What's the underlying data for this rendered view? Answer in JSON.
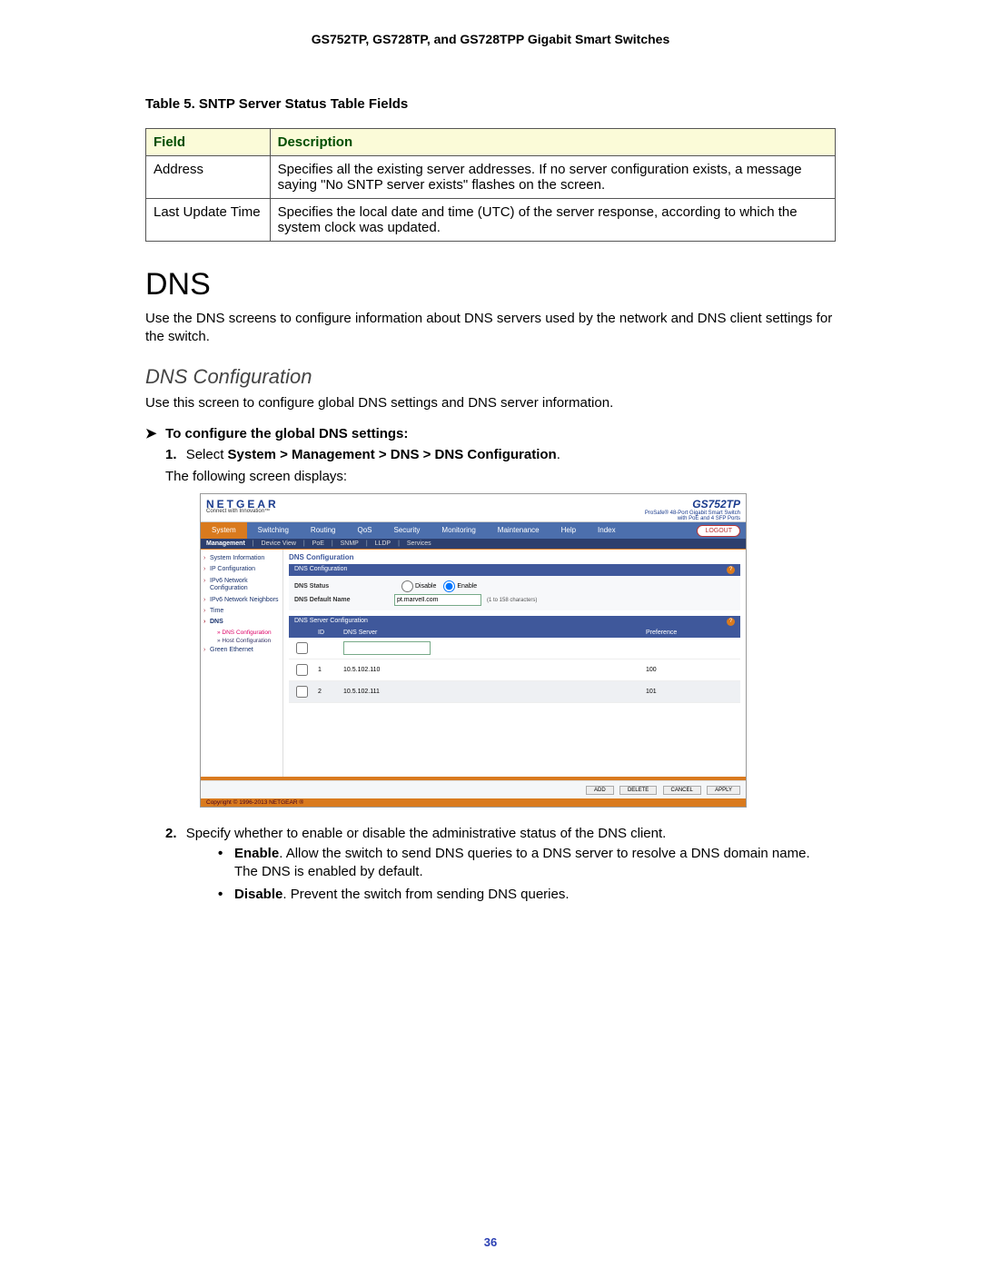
{
  "doc_title": "GS752TP, GS728TP, and GS728TPP Gigabit Smart Switches",
  "table_caption": "Table 5.  SNTP Server Status Table Fields",
  "table5": {
    "headers": [
      "Field",
      "Description"
    ],
    "rows": [
      {
        "field": "Address",
        "desc": "Specifies all the existing server addresses. If no server configuration exists, a message saying \"No SNTP server exists\" flashes on the screen."
      },
      {
        "field": "Last Update Time",
        "desc": "Specifies the local date and time (UTC) of the server response, according to which the system clock was updated."
      }
    ]
  },
  "dns_section": {
    "heading": "DNS",
    "intro": "Use the DNS screens to configure information about DNS servers used by the network and DNS client settings for the switch.",
    "sub_heading": "DNS Configuration",
    "sub_intro": "Use this screen to configure global DNS settings and DNS server information.",
    "procedure_title": "To configure the global DNS settings:",
    "step1_prefix": "Select ",
    "step1_route": "System > Management > DNS > DNS Configuration",
    "step1_suffix": ".",
    "after_step1": "The following screen displays:",
    "step2": "Specify whether to enable or disable the administrative status of the DNS client.",
    "bullets": [
      {
        "term": "Enable",
        "text": ". Allow the switch to send DNS queries to a DNS server to resolve a DNS domain name. The DNS is enabled by default."
      },
      {
        "term": "Disable",
        "text": ". Prevent the switch from sending DNS queries."
      }
    ]
  },
  "screenshot": {
    "brand": "NETGEAR",
    "tagline": "Connect with Innovation™",
    "model": "GS752TP",
    "model_desc1": "ProSafe® 48-Port Gigabit Smart Switch",
    "model_desc2": "with PoE and 4 SFP Ports",
    "logout": "LOGOUT",
    "tabs": [
      "System",
      "Switching",
      "Routing",
      "QoS",
      "Security",
      "Monitoring",
      "Maintenance",
      "Help",
      "Index"
    ],
    "active_tab": "System",
    "submenu": [
      "Management",
      "Device View",
      "PoE",
      "SNMP",
      "LLDP",
      "Services"
    ],
    "submenu_active": "Management",
    "sidebar": [
      "System Information",
      "IP Configuration",
      "IPv6 Network Configuration",
      "IPv6 Network Neighbors",
      "Time",
      "DNS",
      "Green Ethernet"
    ],
    "sidebar_subs": [
      "DNS Configuration",
      "Host Configuration"
    ],
    "sidebar_sub_active": "DNS Configuration",
    "panel_main_title": "DNS Configuration",
    "panel1_title": "DNS Configuration",
    "dns_status_label": "DNS Status",
    "dns_status_disable": "Disable",
    "dns_status_enable": "Enable",
    "dns_default_label": "DNS Default Name",
    "dns_default_value": "pt.marvell.com",
    "dns_default_hint": "(1 to 158 characters)",
    "panel2_title": "DNS Server Configuration",
    "srv_headers": [
      "",
      "ID",
      "DNS Server",
      "Preference"
    ],
    "srv_rows": [
      {
        "id": "1",
        "server": "10.5.102.110",
        "pref": "100"
      },
      {
        "id": "2",
        "server": "10.5.102.111",
        "pref": "101"
      }
    ],
    "footer_buttons": [
      "ADD",
      "DELETE",
      "CANCEL",
      "APPLY"
    ],
    "copyright": "Copyright © 1996-2013 NETGEAR ®"
  },
  "page_number": "36"
}
